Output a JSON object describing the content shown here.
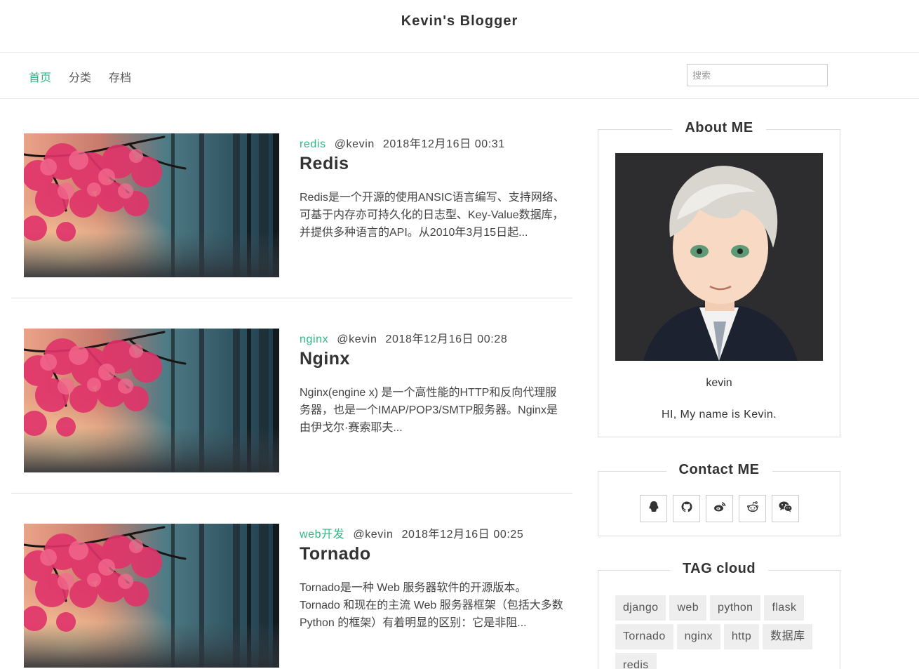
{
  "site": {
    "title": "Kevin's Blogger"
  },
  "nav": {
    "items": [
      {
        "label": "首页",
        "active": true
      },
      {
        "label": "分类",
        "active": false
      },
      {
        "label": "存档",
        "active": false
      }
    ],
    "search_placeholder": "搜索"
  },
  "posts": [
    {
      "category": "redis",
      "author": "@kevin",
      "date": "2018年12月16日 00:31",
      "title": "Redis",
      "excerpt": "Redis是一个开源的使用ANSIC语言编写、支持网络、可基于内存亦可持久化的日志型、Key-Value数据库，并提供多种语言的API。从2010年3月15日起..."
    },
    {
      "category": "nginx",
      "author": "@kevin",
      "date": "2018年12月16日 00:28",
      "title": "Nginx",
      "excerpt": "Nginx(engine x) 是一个高性能的HTTP和反向代理服务器，也是一个IMAP/POP3/SMTP服务器。Nginx是由伊戈尔·赛索耶夫..."
    },
    {
      "category": "web开发",
      "author": "@kevin",
      "date": "2018年12月16日 00:25",
      "title": "Tornado",
      "excerpt": "Tornado是一种 Web 服务器软件的开源版本。Tornado 和现在的主流 Web 服务器框架（包括大多数 Python 的框架）有着明显的区别：它是非阻..."
    }
  ],
  "sidebar": {
    "about": {
      "title": "About ME",
      "name": "kevin",
      "bio": "HI, My name is Kevin."
    },
    "contact": {
      "title": "Contact ME",
      "icons": [
        "qq-icon",
        "github-icon",
        "weibo-icon",
        "reddit-icon",
        "wechat-icon"
      ]
    },
    "tags": {
      "title": "TAG cloud",
      "items": [
        "django",
        "web",
        "python",
        "flask",
        "Tornado",
        "nginx",
        "http",
        "数据库",
        "redis"
      ]
    }
  },
  "colors": {
    "accent": "#2bba85",
    "border": "#dddddd",
    "tag_bg": "#eeeeee"
  }
}
